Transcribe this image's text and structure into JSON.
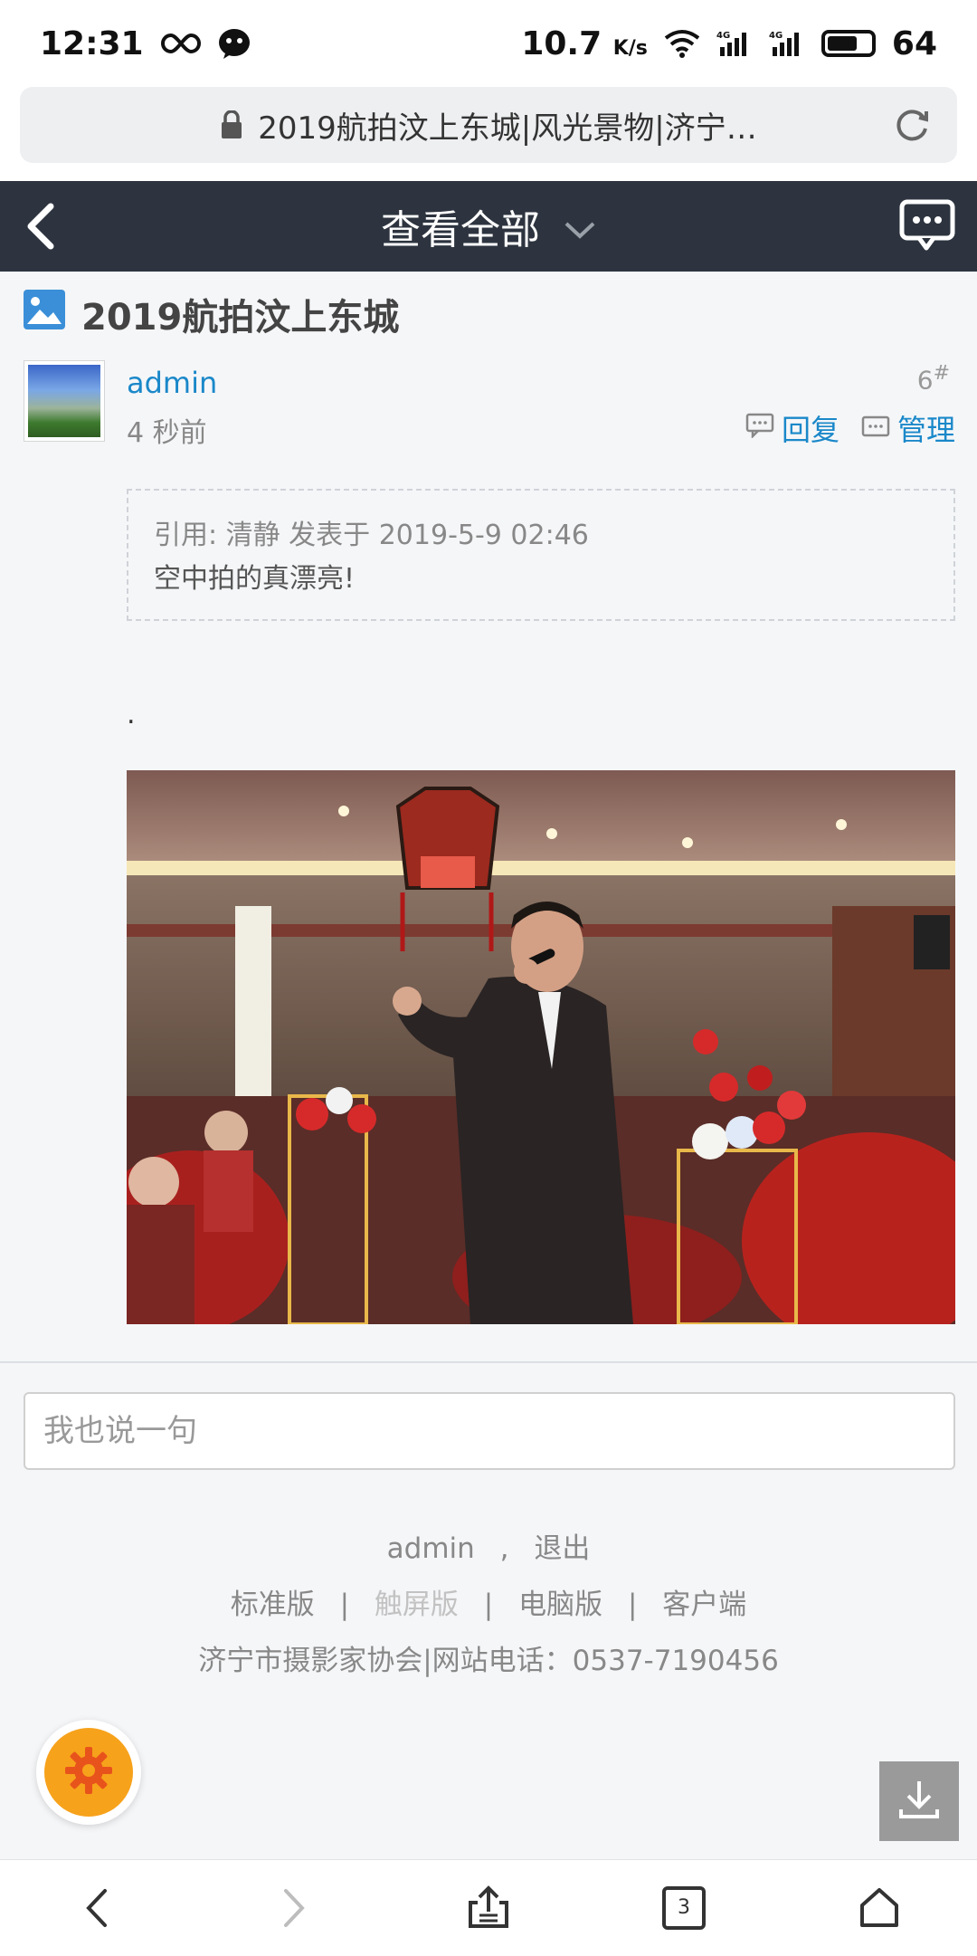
{
  "status_bar": {
    "time": "12:31",
    "speed": "10.7",
    "speed_unit": "K/s",
    "battery": "64"
  },
  "browser": {
    "url_title": "2019航拍汶上东城|风光景物|济宁…",
    "tab_count": "3"
  },
  "nav": {
    "title": "查看全部"
  },
  "thread": {
    "title": "2019航拍汶上东城"
  },
  "post": {
    "author": "admin",
    "time": "4 秒前",
    "floor": "6",
    "floor_mark": "#",
    "reply_label": "回复",
    "manage_label": "管理",
    "quote_header": "引用: 清静 发表于 2019-5-9 02:46",
    "quote_body": "空中拍的真漂亮!",
    "text": "."
  },
  "reply": {
    "placeholder": "我也说一句"
  },
  "footer": {
    "user": "admin",
    "comma": ",",
    "logout": "退出",
    "links": [
      "标准版",
      "触屏版",
      "电脑版",
      "客户端"
    ],
    "separator": "|",
    "info": "济宁市摄影家协会|网站电话：0537-7190456"
  },
  "colors": {
    "navbar": "#2d343f",
    "link": "#1a88c9",
    "fab": "#f7a21b"
  }
}
